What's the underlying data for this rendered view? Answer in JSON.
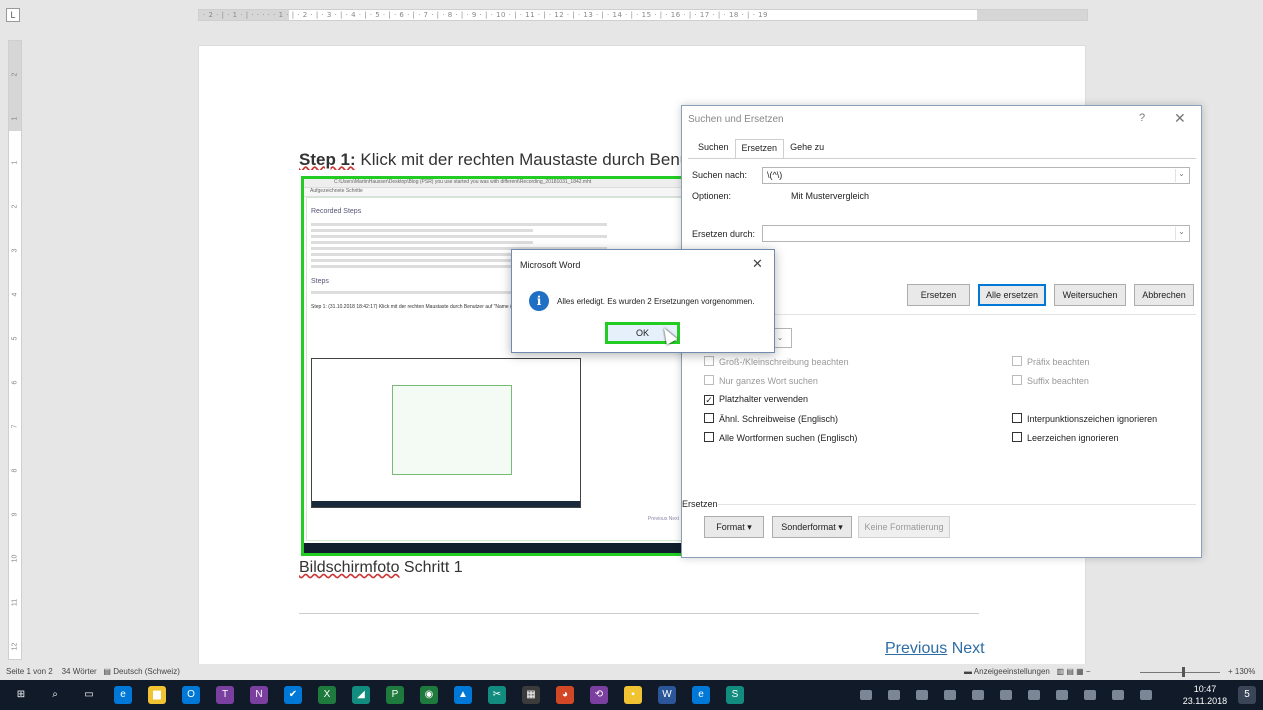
{
  "ruler": {
    "tab_selector": "L",
    "horizontal_text": "· 2 · | · 1 · | · · · · · 1 · | · 2 · | · 3 · | · 4 · | · 5 · | · 6 · | · 7 · | · 8 · | · 9 · | · 10 · | · 11 · | · 12 · | · 13 · | · 14 · | · 15 · | · 16 · | · 17 · | · 18 · | · 19",
    "vertical_numbers": [
      "2",
      "1",
      "1",
      "2",
      "3",
      "4",
      "5",
      "6",
      "7",
      "8",
      "9",
      "10",
      "11",
      "12"
    ]
  },
  "document": {
    "step_label": "Step 1:",
    "step_text": "Klick mit der rechten Maustaste durch Benutze",
    "caption_word": "Bildschirmfoto",
    "caption_rest": " Schritt 1",
    "nav_previous": "Previous",
    "nav_next": "Next",
    "embedded": {
      "path": "C:\\Users\\MartinHausser\\Desktop\\Blog (PSR) you use started you was with different\\Recording_20181031_1842.mht",
      "toolbar": "Aufgezeichnete Schritte",
      "heading": "Recorded Steps",
      "steps_heading": "Steps",
      "step1": "Step 1: (31.10.2018 18:42:17) Klick mit der rechten Maustaste durch Benutzer auf \"Name (Seitenleiste)\" in \"Ex\"",
      "previous_next": "Previous Next"
    }
  },
  "find_replace": {
    "title": "Suchen und Ersetzen",
    "help": "?",
    "close": "✕",
    "tabs": [
      "Suchen",
      "Ersetzen",
      "Gehe zu"
    ],
    "active_tab": "Ersetzen",
    "search_label": "Suchen nach:",
    "search_value": "\\(^\\)",
    "options_label": "Optionen:",
    "options_value": "Mit Mustervergleich",
    "replace_label": "Ersetzen durch:",
    "replace_value": "",
    "buttons": {
      "replace": "Ersetzen",
      "replace_all": "Alle ersetzen",
      "find_next": "Weitersuchen",
      "cancel": "Abbrechen"
    },
    "options": {
      "match_case": "Groß-/Kleinschreibung beachten",
      "whole_word": "Nur ganzes Wort suchen",
      "wildcards": "Platzhalter verwenden",
      "sounds_like": "Ähnl. Schreibweise (Englisch)",
      "word_forms": "Alle Wortformen suchen (Englisch)",
      "prefix": "Präfix beachten",
      "suffix": "Suffix beachten",
      "ignore_punct": "Interpunktionszeichen ignorieren",
      "ignore_space": "Leerzeichen ignorieren"
    },
    "wildcards_checked": true,
    "replace_section": "Ersetzen",
    "format_button": "Format ▾",
    "special_button": "Sonderformat ▾",
    "no_format_button": "Keine Formatierung"
  },
  "message_box": {
    "title": "Microsoft Word",
    "close": "✕",
    "icon": "i",
    "message": "Alles erledigt. Es wurden 2 Ersetzungen vorgenommen.",
    "ok": "OK"
  },
  "status_bar": {
    "page": "Seite 1 von 2",
    "words": "34 Wörter",
    "language": "Deutsch (Schweiz)",
    "display_settings": "Anzeigeeinstellungen",
    "zoom": "130%",
    "zoom_minus": "−",
    "zoom_plus": "+"
  },
  "taskbar": {
    "time": "10:47",
    "date": "23.11.2018",
    "notifications": "5",
    "icons": [
      "windows-start-icon",
      "search-icon",
      "task-view-icon",
      "edge-browser-icon",
      "file-explorer-icon",
      "outlook-icon",
      "teams-icon",
      "onenote-icon",
      "todo-check-icon",
      "excel-icon",
      "paint-icon",
      "project-icon",
      "whatsapp-icon",
      "photos-icon",
      "snipping-icon",
      "calculator-icon",
      "chrome-icon",
      "steps-recorder-icon",
      "sticky-notes-icon",
      "word-icon",
      "internet-explorer-icon",
      "sway-icon"
    ],
    "colors": {
      "blue": "#0078d7",
      "orange": "#d24726",
      "purple": "#7b3fa0",
      "green": "#1f7a3d",
      "yellow": "#f1c232",
      "teal": "#128c7e",
      "word": "#2b579a"
    }
  }
}
